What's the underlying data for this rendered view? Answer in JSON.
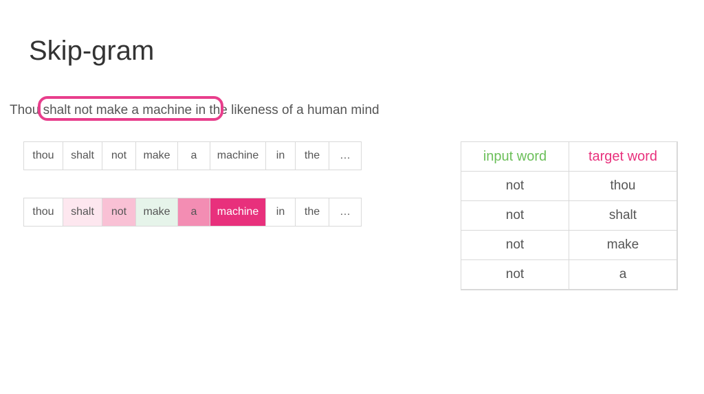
{
  "title": "Skip-gram",
  "sentence": "Thou shalt not make a machine in the likeness of a human mind",
  "tokens_plain": [
    "thou",
    "shalt",
    "not",
    "make",
    "a",
    "machine",
    "in",
    "the",
    "…"
  ],
  "tokens_colored": [
    {
      "text": "thou",
      "cls": ""
    },
    {
      "text": "shalt",
      "cls": "bg-pink0"
    },
    {
      "text": "not",
      "cls": "bg-pink1"
    },
    {
      "text": "make",
      "cls": "bg-green"
    },
    {
      "text": "a",
      "cls": "bg-pink2"
    },
    {
      "text": "machine",
      "cls": "bg-pink3"
    },
    {
      "text": "in",
      "cls": ""
    },
    {
      "text": "the",
      "cls": ""
    },
    {
      "text": "…",
      "cls": ""
    }
  ],
  "pair_table": {
    "headers": {
      "input": "input word",
      "target": "target word"
    },
    "rows": [
      {
        "input": "not",
        "target": "thou"
      },
      {
        "input": "not",
        "target": "shalt"
      },
      {
        "input": "not",
        "target": "make"
      },
      {
        "input": "not",
        "target": "a"
      }
    ]
  },
  "widths": [
    "w-thou",
    "w-shalt",
    "w-not",
    "w-make",
    "w-a",
    "w-machine",
    "w-in",
    "w-the",
    "w-ell"
  ]
}
